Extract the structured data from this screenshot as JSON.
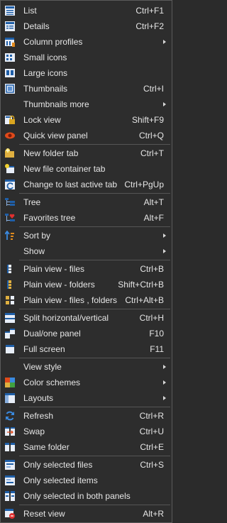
{
  "menu": {
    "items": [
      {
        "label": "List",
        "shortcut": "Ctrl+F1",
        "icon": "list-view-icon"
      },
      {
        "label": "Details",
        "shortcut": "Ctrl+F2",
        "icon": "details-view-icon"
      },
      {
        "label": "Column profiles",
        "shortcut": "",
        "submenu": true,
        "icon": "column-profiles-icon"
      },
      {
        "label": "Small icons",
        "shortcut": "",
        "icon": "small-icons-icon"
      },
      {
        "label": "Large icons",
        "shortcut": "",
        "icon": "large-icons-icon"
      },
      {
        "label": "Thumbnails",
        "shortcut": "Ctrl+I",
        "icon": "thumbnails-icon"
      },
      {
        "label": "Thumbnails more",
        "shortcut": "",
        "submenu": true,
        "icon": ""
      },
      {
        "label": "Lock view",
        "shortcut": "Shift+F9",
        "icon": "lock-view-icon"
      },
      {
        "label": "Quick view panel",
        "shortcut": "Ctrl+Q",
        "icon": "eye-icon"
      },
      {
        "sep": true
      },
      {
        "label": "New folder tab",
        "shortcut": "Ctrl+T",
        "icon": "new-folder-tab-icon"
      },
      {
        "label": "New file container tab",
        "shortcut": "",
        "icon": "new-container-tab-icon"
      },
      {
        "label": "Change to last active tab",
        "shortcut": "Ctrl+PgUp",
        "icon": "last-tab-icon"
      },
      {
        "sep": true
      },
      {
        "label": "Tree",
        "shortcut": "Alt+T",
        "icon": "tree-icon"
      },
      {
        "label": "Favorites tree",
        "shortcut": "Alt+F",
        "icon": "favorites-tree-icon"
      },
      {
        "sep": true
      },
      {
        "label": "Sort by",
        "shortcut": "",
        "submenu": true,
        "icon": "sort-icon"
      },
      {
        "label": "Show",
        "shortcut": "",
        "submenu": true,
        "icon": ""
      },
      {
        "sep": true
      },
      {
        "label": "Plain view - files",
        "shortcut": "Ctrl+B",
        "icon": "plain-view-files-icon"
      },
      {
        "label": "Plain view - folders",
        "shortcut": "Shift+Ctrl+B",
        "icon": "plain-view-folders-icon"
      },
      {
        "label": "Plain view - files , folders",
        "shortcut": "Ctrl+Alt+B",
        "icon": "plain-view-files-folders-icon"
      },
      {
        "sep": true
      },
      {
        "label": "Split horizontal/vertical",
        "shortcut": "Ctrl+H",
        "icon": "split-icon"
      },
      {
        "label": "Dual/one panel",
        "shortcut": "F10",
        "icon": "dual-panel-icon"
      },
      {
        "label": "Full screen",
        "shortcut": "F11",
        "icon": "full-screen-icon"
      },
      {
        "sep": true
      },
      {
        "label": "View style",
        "shortcut": "",
        "submenu": true,
        "icon": ""
      },
      {
        "label": "Color schemes",
        "shortcut": "",
        "submenu": true,
        "icon": "color-schemes-icon"
      },
      {
        "label": "Layouts",
        "shortcut": "",
        "submenu": true,
        "icon": "layouts-icon"
      },
      {
        "sep": true
      },
      {
        "label": "Refresh",
        "shortcut": "Ctrl+R",
        "icon": "refresh-icon"
      },
      {
        "label": "Swap",
        "shortcut": "Ctrl+U",
        "icon": "swap-icon"
      },
      {
        "label": "Same folder",
        "shortcut": "Ctrl+E",
        "icon": "same-folder-icon"
      },
      {
        "sep": true
      },
      {
        "label": "Only selected files",
        "shortcut": "Ctrl+S",
        "icon": "only-selected-files-icon"
      },
      {
        "label": "Only selected items",
        "shortcut": "",
        "icon": "only-selected-items-icon"
      },
      {
        "label": "Only selected in both panels",
        "shortcut": "",
        "icon": "only-selected-both-icon"
      },
      {
        "sep": true
      },
      {
        "label": "Reset view",
        "shortcut": "Alt+R",
        "icon": "reset-view-icon"
      }
    ]
  }
}
